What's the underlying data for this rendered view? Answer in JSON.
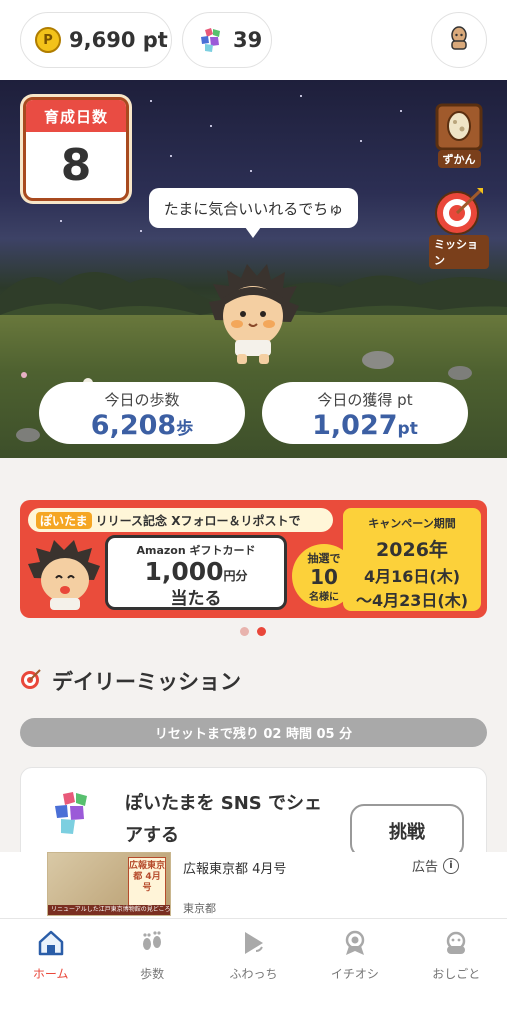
{
  "topbar": {
    "points_value": "9,690 pt",
    "coin_symbol": "P",
    "gems_value": "39"
  },
  "hero": {
    "days_label": "育成日数",
    "days_value": "8",
    "zukan_label": "ずかん",
    "mission_label": "ミッション",
    "speech": "たまに気合いいれるでちゅ",
    "steps": {
      "label": "今日の歩数",
      "value": "6,208",
      "unit": "歩"
    },
    "earned": {
      "label": "今日の獲得 pt",
      "value": "1,027",
      "unit": "pt"
    }
  },
  "banner": {
    "tag": "ぽいたま",
    "headline": "リリース記念 Xフォロー＆リポストで",
    "gift_brand": "Amazon ギフトカード",
    "gift_amount": "1,000",
    "gift_unit": "円分",
    "gift_win": "当たる",
    "lottery_prefix": "抽選で",
    "lottery_count": "10",
    "lottery_suffix": "名様に",
    "period_label": "キャンペーン期間",
    "period_year": "2026年",
    "period_start": "4月16日(木)",
    "period_end": "〜4月23日(木)",
    "carousel_active_index": 2,
    "carousel_total": 2
  },
  "daily_mission": {
    "title": "デイリーミッション",
    "reset_text": "リセットまで残り 02 時間 05 分",
    "mission_text": "ぽいたまを SNS でシェアする",
    "challenge_label": "挑戦"
  },
  "ad": {
    "title": "広報東京都 4月号",
    "source": "東京都",
    "label": "広告",
    "info_symbol": "i",
    "badge_text": "広報東京都 4月号",
    "strip_text": "リニューアルした江戸東京博物館の見どころを解説！"
  },
  "nav": {
    "items": [
      {
        "label": "ホーム",
        "icon": "home-icon",
        "active": true
      },
      {
        "label": "歩数",
        "icon": "footprints-icon",
        "active": false
      },
      {
        "label": "ふわっち",
        "icon": "play-icon",
        "active": false
      },
      {
        "label": "イチオシ",
        "icon": "award-icon",
        "active": false
      },
      {
        "label": "おしごと",
        "icon": "pet-icon",
        "active": false
      }
    ]
  },
  "colors": {
    "accent_red": "#e9473a",
    "stat_blue": "#3c5fa3",
    "banner_red": "#ea4c3b",
    "banner_yellow": "#fcd13a"
  }
}
